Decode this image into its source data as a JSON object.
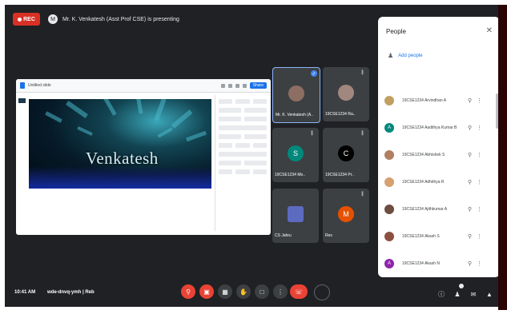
{
  "top_bar": {
    "rec_label": "REC",
    "presenting_text": "Mr. K. Venkatesh (Asst Prof CSE) is presenting",
    "presenter_initial": "M"
  },
  "slides_app": {
    "title": "Untitled slide",
    "share_label": "Share",
    "slide_title": "Venkatesh"
  },
  "tiles": [
    {
      "name": "Mr. K. Venkatesh (A..",
      "initial": "",
      "color": "#8d6e63"
    },
    {
      "name": "19CSE1234 Ra..",
      "initial": "",
      "color": "#a1887f"
    },
    {
      "name": "19CSE1234 Mo..",
      "initial": "S",
      "color": "#00897b"
    },
    {
      "name": "19CSE1234 Pr..",
      "initial": "C",
      "color": "#000000"
    },
    {
      "name": "CS Jahru",
      "initial": "",
      "color": "#5c6bc0"
    },
    {
      "name": "Rex",
      "initial": "M",
      "color": "#e65100"
    }
  ],
  "people_panel": {
    "title": "People",
    "add_people": "Add people",
    "participants": [
      {
        "name": "19CSE1234 Arvindhan A",
        "color": "#c0a060",
        "initial": ""
      },
      {
        "name": "19CSE1234 Aadithya Kumar B",
        "color": "#00897b",
        "initial": "A"
      },
      {
        "name": "19CSE1234 Abhishek S",
        "color": "#b08060",
        "initial": ""
      },
      {
        "name": "19CSE1234 Adhithya R",
        "color": "#d7a070",
        "initial": ""
      },
      {
        "name": "19CSE1234 Ajithkumar A",
        "color": "#6d4c41",
        "initial": ""
      },
      {
        "name": "19CSE1234 Akash S",
        "color": "#8d5040",
        "initial": ""
      },
      {
        "name": "19CSE1234 Akash N",
        "color": "#8e24aa",
        "initial": "A"
      }
    ]
  },
  "bottom_bar": {
    "time": "10:41 AM",
    "meeting_code": "wde-dnvq-ymh | Reb"
  }
}
